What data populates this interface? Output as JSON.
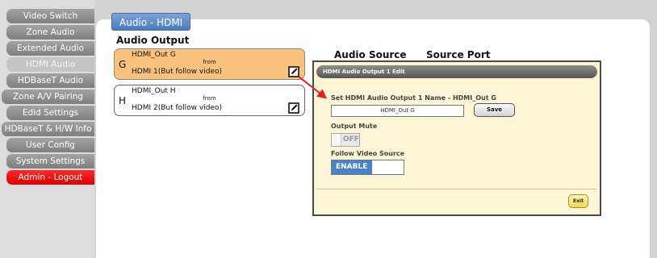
{
  "sidebar": {
    "items": [
      {
        "label": "Video Switch"
      },
      {
        "label": "Zone Audio"
      },
      {
        "label": "Extended Audio"
      },
      {
        "label": "HDMI Audio"
      },
      {
        "label": "HDBaseT Audio"
      },
      {
        "label": "Zone A/V Pairing"
      },
      {
        "label": "Edid Settings"
      },
      {
        "label": "HDBaseT & H/W Info"
      },
      {
        "label": "User Config"
      },
      {
        "label": "System Settings"
      },
      {
        "label": "Admin - Logout"
      }
    ]
  },
  "header": {
    "tab_title": "Audio - HDMI"
  },
  "outputs": {
    "title": "Audio Output",
    "cards": [
      {
        "letter": "G",
        "name": "HDMI_Out G",
        "from": "from",
        "source": "HDMI 1(But follow video)"
      },
      {
        "letter": "H",
        "name": "HDMI_Out H",
        "from": "from",
        "source": "HDMI 2(But follow video)"
      }
    ]
  },
  "columns": {
    "audio_source": "Audio Source",
    "source_port": "Source Port"
  },
  "dialog": {
    "title": "HDMI Audio Output 1 Edit",
    "name_label": "Set HDMI Audio Output 1 Name - HDMI_Out G",
    "name_value": "HDMI_Out G",
    "save_label": "Save",
    "mute_label": "Output Mute",
    "mute_state": "OFF",
    "follow_label": "Follow Video Source",
    "follow_state": "ENABLE",
    "exit_label": "Exit"
  },
  "colors": {
    "selected_card": "#fac27c",
    "logout": "#e00000",
    "tab": "#4c7bbc",
    "toggle_on": "#4a82c8",
    "arrow": "#e02020"
  },
  "icons": {
    "edit": "edit-icon"
  }
}
